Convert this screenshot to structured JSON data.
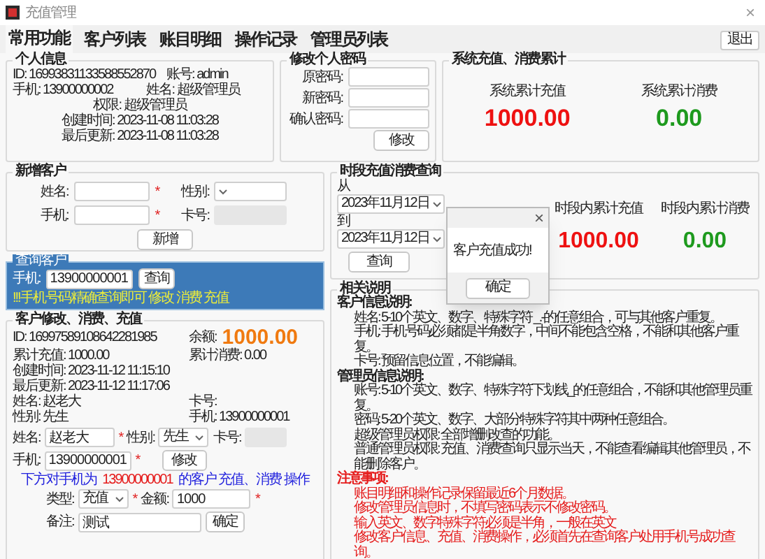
{
  "window": {
    "title": "充值管理",
    "close": "×"
  },
  "tabs": [
    {
      "label": "常用功能",
      "selected": true
    },
    {
      "label": "客户列表",
      "selected": false
    },
    {
      "label": "账目明细",
      "selected": false
    },
    {
      "label": "操作记录",
      "selected": false
    },
    {
      "label": "管理员列表",
      "selected": false
    }
  ],
  "logout_button": "退出",
  "personal_info": {
    "title": "个人信息",
    "id": "ID: 16993831133588552870",
    "account": "账号: admin",
    "phone": "手机: 13900000002",
    "name": "姓名: 超级管理员",
    "role": "权限: 超级管理员",
    "created": "创建时间: 2023-11-08 11:03:28",
    "updated": "最后更新: 2023-11-08 11:03:28"
  },
  "change_password": {
    "title": "修改个人密码",
    "fields": [
      {
        "label": "原密码:"
      },
      {
        "label": "新密码:"
      },
      {
        "label": "确认密码:"
      }
    ],
    "button": "修改"
  },
  "system_totals": {
    "title": "系统充值、消费累计",
    "stats": [
      {
        "label": "系统累计充值",
        "value": "1000.00",
        "kind": "recharge"
      },
      {
        "label": "系统累计消费",
        "value": "0.00",
        "kind": "consume"
      }
    ]
  },
  "new_customer": {
    "title": "新增客户",
    "name_label": "姓名:",
    "name_required": "*",
    "gender_label": "性别:",
    "phone_label": "手机:",
    "phone_required": "*",
    "card_label": "卡号:",
    "button": "新增"
  },
  "query_customer": {
    "title": "查询客户",
    "phone_label": "手机:",
    "phone_value": "13900000001",
    "button": "查询",
    "hint": "!!!手机号码精确查询即可 修改 消费 充值"
  },
  "edit_customer": {
    "title": "客户修改、消费、充值",
    "id": "ID: 16997589108642281985",
    "balance_label": "余额:",
    "balance": "1000.00",
    "total_recharge": "累计充值: 1000.00",
    "total_consume": "累计消费: 0.00",
    "created": "创建时间: 2023-11-12 11:15:10",
    "updated": "最后更新: 2023-11-12 11:17:06",
    "name": "姓名: 赵老大",
    "card": "卡号:",
    "gender": "性别: 先生",
    "phone": "手机: 13900000001",
    "form": {
      "name_label": "姓名:",
      "name_value": "赵老大",
      "name_required": "*",
      "gender_label": "性别:",
      "gender_value": "先生",
      "card_label": "卡号:",
      "phone_label": "手机:",
      "phone_value": "13900000001",
      "phone_required": "*",
      "button": "修改"
    },
    "notice": [
      {
        "text": "下方对手机为",
        "kind": "normal"
      },
      {
        "text": "13900000001",
        "kind": "highlight"
      },
      {
        "text": "的客户 充值、消费 操作",
        "kind": "normal"
      }
    ],
    "type_label": "类型:",
    "type_value": "充值",
    "type_required": "*",
    "amount_label": "金额:",
    "amount_value": "1000",
    "amount_required": "*",
    "remark_label": "备注:",
    "remark_value": "测试",
    "confirm_button": "确定"
  },
  "period_query": {
    "title": "时段充值消费查询",
    "from_label": "从",
    "from_date": "2023年11月12日",
    "to_label": "到",
    "to_date": "2023年11月12日",
    "button": "查询",
    "stats": [
      {
        "label": "时段内累计充值",
        "value": "1000.00",
        "kind": "recharge"
      },
      {
        "label": "时段内累计消费",
        "value": "0.00",
        "kind": "consume"
      }
    ]
  },
  "notes": {
    "title": "相关说明",
    "sections": [
      {
        "heading": "客户信息说明:",
        "kind": "normal",
        "lines": [
          "姓名: 5-10个英文、数字、特殊字符 _.-的任意组合，可与其他客户重复。",
          "手机: 手机号码必须都是半角数字，中间不能包含空格，不能和其他客户重复。",
          "卡号: 预留信息位置，不能编辑。"
        ]
      },
      {
        "heading": "管理员信息说明:",
        "kind": "normal",
        "lines": [
          "账号: 5-10个英文、数字、特殊字符下划线_的任意组合，不能和其他管理员重复。",
          "密码: 5-20个英文、数字、大部分特殊字符其中两种任意组合。",
          "超级管理员权限: 全部增删改查的功能。",
          "普通管理员权限: 充值、消费查询只显示当天，不能查看编辑其他管理员，不能删除客户。"
        ]
      },
      {
        "heading": "注意事项:",
        "kind": "warning",
        "lines": [
          "账目明细和操作记录保留最近6个月数据。",
          "修改管理员信息时，不填写密码表示不修改密码。",
          "输入英文、数字特殊字符必须是半角，一般在英文",
          "修改客户信息、充值、消费操作，必须首先在查询客户处用手机号成功查询。"
        ]
      }
    ]
  },
  "dialog": {
    "close": "×",
    "message": "客户充值成功!",
    "button": "确定"
  }
}
